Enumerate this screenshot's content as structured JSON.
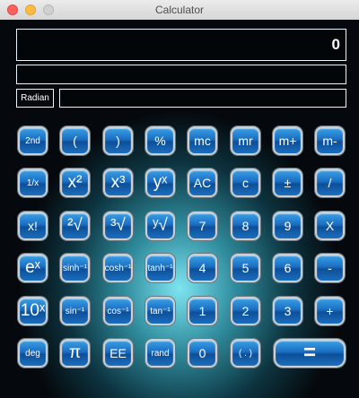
{
  "window": {
    "title": "Calculator"
  },
  "display": {
    "main_value": "0",
    "secondary": "",
    "expression": "",
    "mode": "Radian"
  },
  "buttons": {
    "r1": [
      "2nd",
      "(",
      ")",
      "%",
      "mc",
      "mr",
      "m+",
      "m-"
    ],
    "r2": [
      "1/x",
      "x²",
      "x³",
      "yˣ",
      "AC",
      "c",
      "±",
      "/"
    ],
    "r3": [
      "x!",
      "²√",
      "³√",
      "ʸ√",
      "7",
      "8",
      "9",
      "X"
    ],
    "r4": [
      "eˣ",
      "sinh⁻¹",
      "cosh⁻¹",
      "tanh⁻¹",
      "4",
      "5",
      "6",
      "-"
    ],
    "r5": [
      "10ˣ",
      "sin⁻¹",
      "cos⁻¹",
      "tan⁻¹",
      "1",
      "2",
      "3",
      "+"
    ],
    "r6": [
      "deg",
      "π",
      "EE",
      "rand",
      "0",
      "( . )",
      "="
    ]
  }
}
